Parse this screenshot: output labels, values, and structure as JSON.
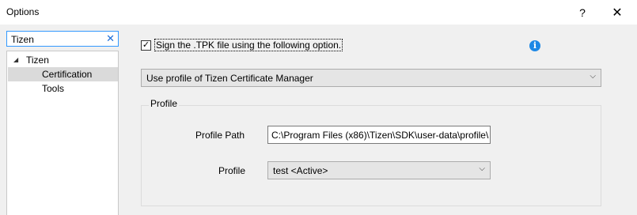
{
  "window": {
    "title": "Options",
    "help_glyph": "?",
    "close_glyph": "✕"
  },
  "search": {
    "value": "Tizen",
    "clear_glyph": "✕"
  },
  "tree": {
    "root": {
      "label": "Tizen",
      "toggle": "◢"
    },
    "items": [
      {
        "label": "Certification",
        "selected": true
      },
      {
        "label": "Tools",
        "selected": false
      }
    ]
  },
  "content": {
    "sign_checkbox": {
      "checked": true,
      "glyph": "✓",
      "label": "Sign the .TPK file using the following option."
    },
    "info_icon": {
      "name": "info-icon",
      "glyph": "i",
      "color": "#1e88e5"
    },
    "profile_source_select": {
      "value": "Use profile of Tizen Certificate Manager",
      "arrow": "⌵"
    },
    "profile_group": {
      "legend": "Profile",
      "path_label": "Profile Path",
      "path_value": "C:\\Program Files (x86)\\Tizen\\SDK\\user-data\\profile\\",
      "profile_label": "Profile",
      "profile_value": "test <Active>",
      "profile_arrow": "⌵"
    }
  }
}
